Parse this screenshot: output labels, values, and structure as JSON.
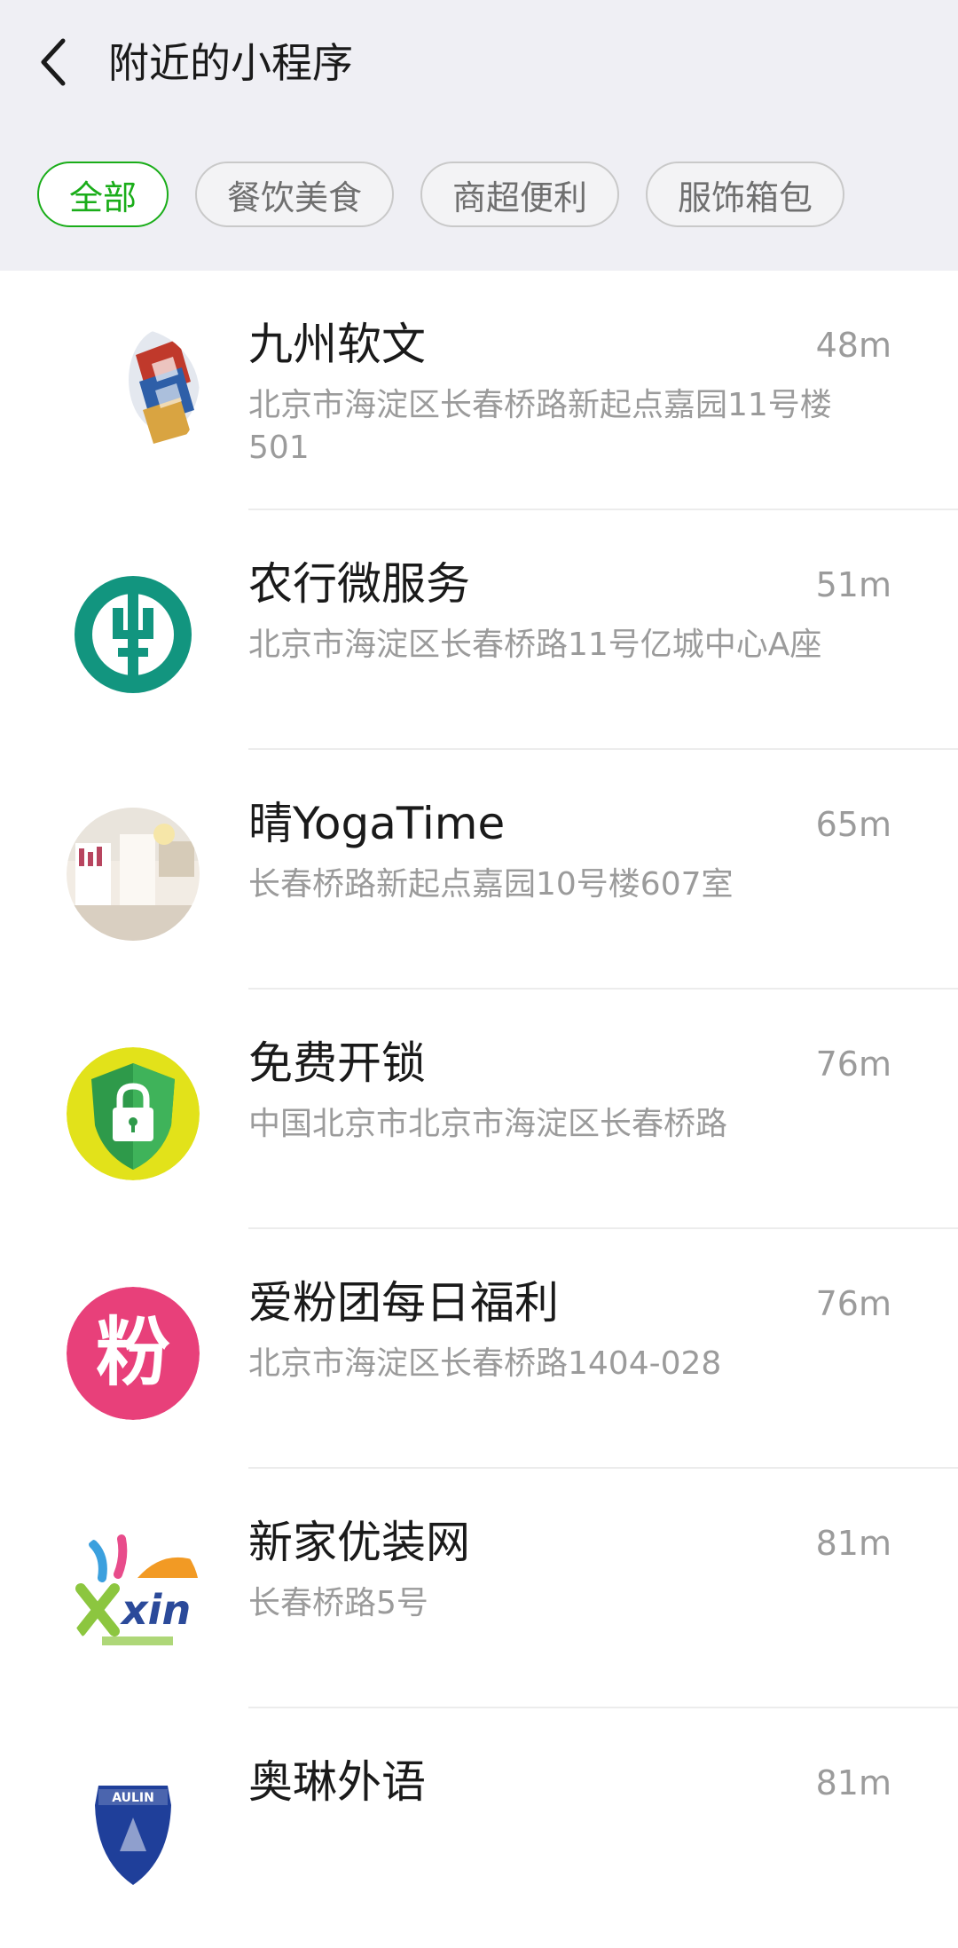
{
  "header": {
    "title": "附近的小程序",
    "filters": [
      "全部",
      "餐饮美食",
      "商超便利",
      "服饰箱包"
    ]
  },
  "colors": {
    "accent": "#1aad19",
    "header_bg": "#efeff4",
    "secondary_text": "#9b9b9b"
  },
  "items": [
    {
      "name": "九州软文",
      "distance": "48m",
      "address": "北京市海淀区长春桥路新起点嘉园11号楼501",
      "icon": "jiuzhou-logo-icon"
    },
    {
      "name": "农行微服务",
      "distance": "51m",
      "address": "北京市海淀区长春桥路11号亿城中心A座",
      "icon": "abc-bank-logo-icon"
    },
    {
      "name": "晴YogaTime",
      "distance": "65m",
      "address": "长春桥路新起点嘉园10号楼607室",
      "icon": "yoga-studio-photo-icon"
    },
    {
      "name": "免费开锁",
      "distance": "76m",
      "address": "中国北京市北京市海淀区长春桥路",
      "icon": "padlock-shield-icon"
    },
    {
      "name": "爱粉团每日福利",
      "distance": "76m",
      "address": "北京市海淀区长春桥路1404-028",
      "icon": "fen-character-icon",
      "icon_text": "粉"
    },
    {
      "name": "新家优装网",
      "distance": "81m",
      "address": "长春桥路5号",
      "icon": "xin-logo-icon",
      "icon_text": "xin"
    },
    {
      "name": "奥琳外语",
      "distance": "81m",
      "address": "",
      "icon": "aulin-crest-icon",
      "icon_text": "AULIN"
    }
  ]
}
